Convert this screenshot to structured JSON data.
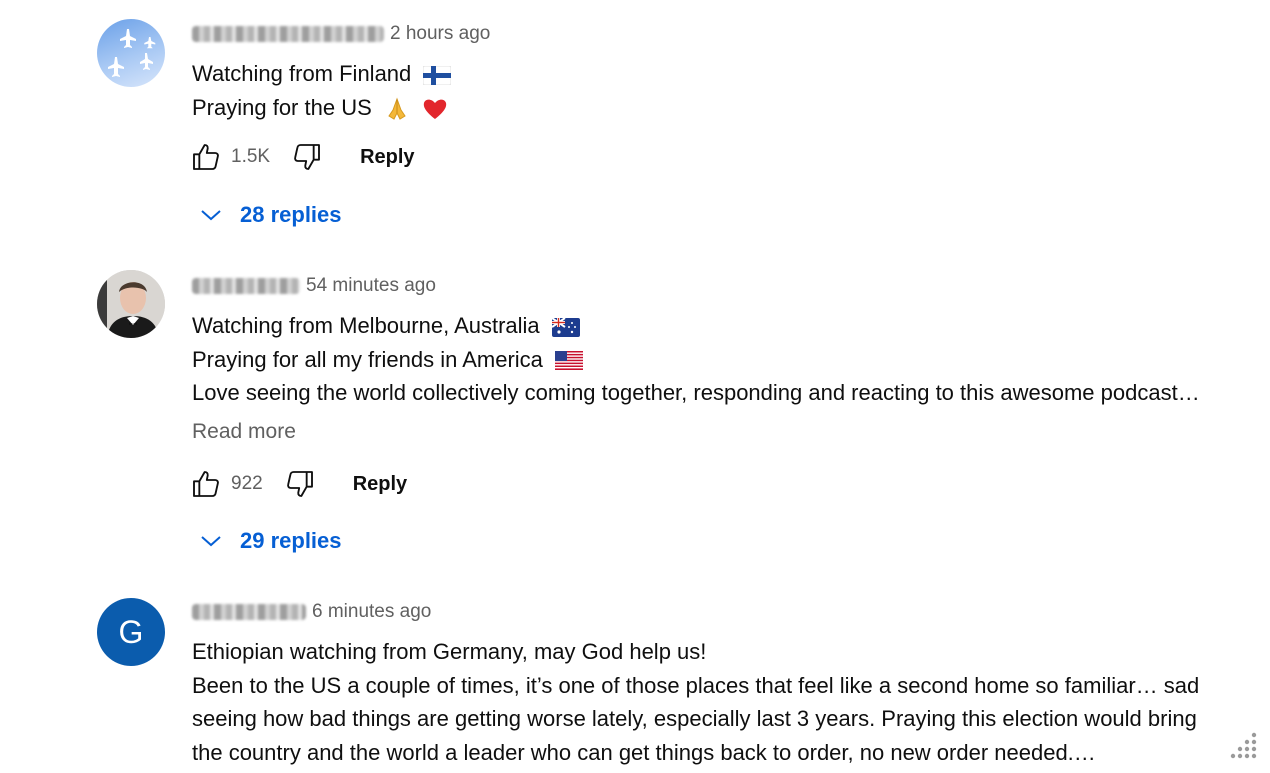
{
  "comments": [
    {
      "handle": "@jxxxjxxxxxx3157",
      "time": "2 hours ago",
      "lines": [
        "Watching from Finland",
        "Praying for the US"
      ],
      "likes": "1.5K",
      "reply_label": "Reply",
      "replies_label": "28 replies",
      "avatar": "airplanes-sky-avatar"
    },
    {
      "handle": "@JackKCK",
      "time": "54 minutes ago",
      "lines": [
        "Watching from Melbourne, Australia",
        "Praying for all my friends in America",
        "Love seeing the world collectively coming together, responding and reacting to this awesome podcast…"
      ],
      "read_more": "Read more",
      "likes": "922",
      "reply_label": "Reply",
      "replies_label": "29 replies",
      "avatar": "man-photo-avatar"
    },
    {
      "handle": "@Gxxxxxxxx",
      "time": "6 minutes ago",
      "avatar_letter": "G",
      "avatar_color": "#0b5cad",
      "lines": [
        "Ethiopian watching from Germany, may God help us!",
        "Been to the US a couple of times, it’s one of those places that feel like a second home so familiar… sad",
        "seeing how bad things are getting worse lately, especially last 3 years. Praying this election would bring",
        "the country and the world a leader who can get things back to order, no new order needed.…"
      ]
    }
  ],
  "colors": {
    "link_blue": "#065fd4",
    "meta_gray": "#606060",
    "text": "#0f0f0f"
  },
  "icons": [
    "thumbs-up-icon",
    "thumbs-down-icon",
    "chevron-down-icon",
    "finland-flag-icon",
    "praying-hands-icon",
    "red-heart-icon",
    "australia-flag-icon",
    "us-flag-icon",
    "drag-dots-icon"
  ]
}
